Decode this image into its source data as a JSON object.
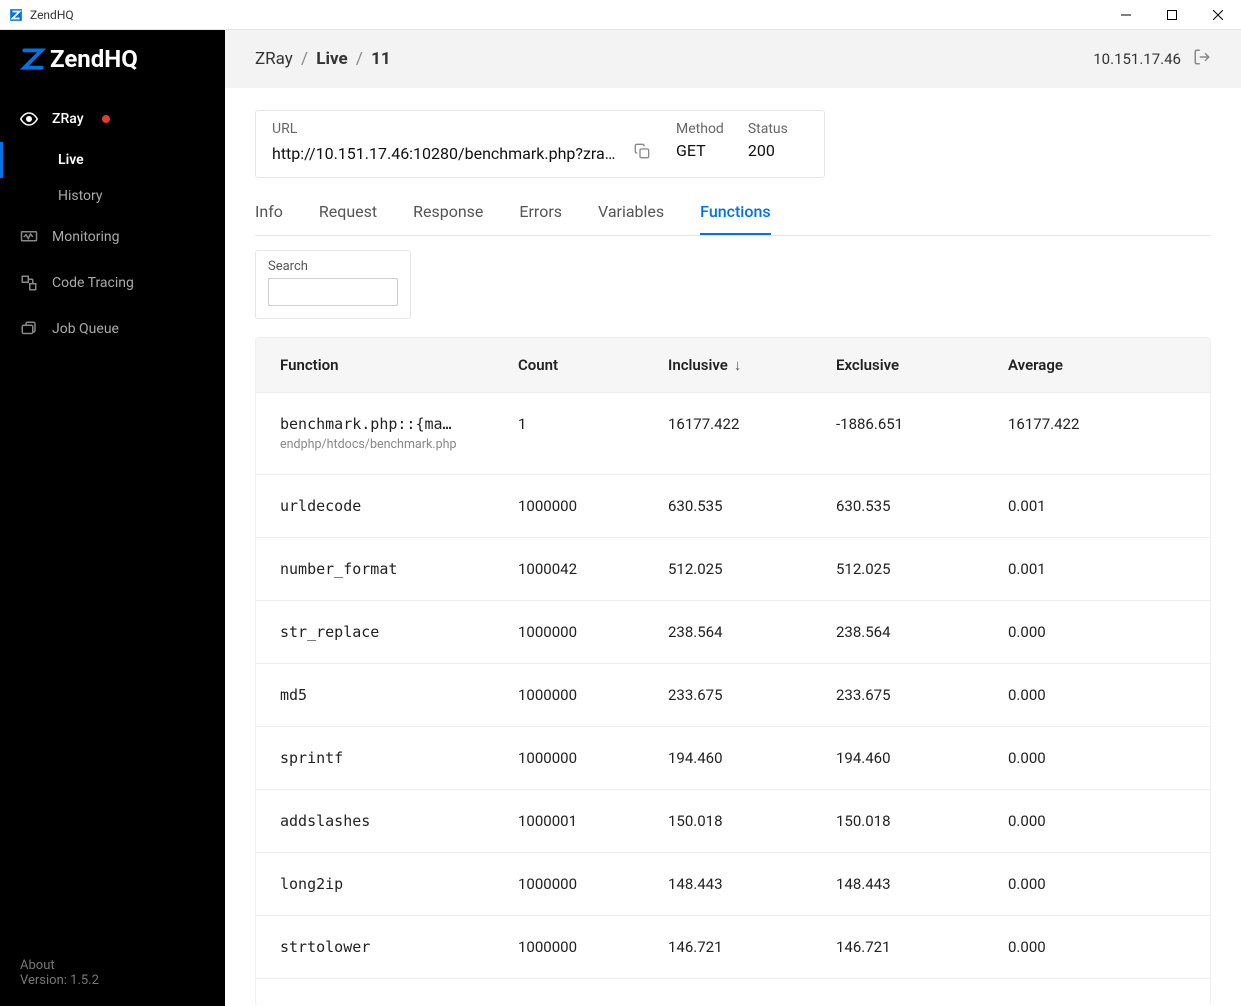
{
  "window": {
    "title": "ZendHQ"
  },
  "brand": {
    "name": "ZendHQ"
  },
  "sidebar": {
    "items": [
      {
        "label": "ZRay",
        "icon": "eye-icon",
        "dot": true
      },
      {
        "label": "Monitoring",
        "icon": "monitor-icon"
      },
      {
        "label": "Code Tracing",
        "icon": "trace-icon"
      },
      {
        "label": "Job Queue",
        "icon": "queue-icon"
      }
    ],
    "zray_sub": [
      {
        "label": "Live",
        "active": true
      },
      {
        "label": "History",
        "active": false
      }
    ],
    "footer": {
      "about": "About",
      "version": "Version: 1.5.2"
    }
  },
  "breadcrumb": {
    "p0": "ZRay",
    "p1": "Live",
    "p2": "11"
  },
  "topbar": {
    "ip": "10.151.17.46"
  },
  "request": {
    "url_label": "URL",
    "url": "http://10.151.17.46:10280/benchmark.php?zra…",
    "method_label": "Method",
    "method": "GET",
    "status_label": "Status",
    "status": "200"
  },
  "tabs": [
    {
      "label": "Info",
      "active": false
    },
    {
      "label": "Request",
      "active": false
    },
    {
      "label": "Response",
      "active": false
    },
    {
      "label": "Errors",
      "active": false
    },
    {
      "label": "Variables",
      "active": false
    },
    {
      "label": "Functions",
      "active": true
    }
  ],
  "search": {
    "label": "Search"
  },
  "table": {
    "headers": {
      "fn": "Function",
      "count": "Count",
      "incl": "Inclusive",
      "excl": "Exclusive",
      "avg": "Average"
    },
    "sort": {
      "column": "incl",
      "dir": "desc"
    },
    "rows": [
      {
        "fn": "benchmark.php::{ma…",
        "path": "endphp/htdocs/benchmark.php",
        "count": "1",
        "incl": "16177.422",
        "excl": "-1886.651",
        "avg": "16177.422"
      },
      {
        "fn": "urldecode",
        "path": "",
        "count": "1000000",
        "incl": "630.535",
        "excl": "630.535",
        "avg": "0.001"
      },
      {
        "fn": "number_format",
        "path": "",
        "count": "1000042",
        "incl": "512.025",
        "excl": "512.025",
        "avg": "0.001"
      },
      {
        "fn": "str_replace",
        "path": "",
        "count": "1000000",
        "incl": "238.564",
        "excl": "238.564",
        "avg": "0.000"
      },
      {
        "fn": "md5",
        "path": "",
        "count": "1000000",
        "incl": "233.675",
        "excl": "233.675",
        "avg": "0.000"
      },
      {
        "fn": "sprintf",
        "path": "",
        "count": "1000000",
        "incl": "194.460",
        "excl": "194.460",
        "avg": "0.000"
      },
      {
        "fn": "addslashes",
        "path": "",
        "count": "1000001",
        "incl": "150.018",
        "excl": "150.018",
        "avg": "0.000"
      },
      {
        "fn": "long2ip",
        "path": "",
        "count": "1000000",
        "incl": "148.443",
        "excl": "148.443",
        "avg": "0.000"
      },
      {
        "fn": "strtolower",
        "path": "",
        "count": "1000000",
        "incl": "146.721",
        "excl": "146.721",
        "avg": "0.000"
      }
    ]
  }
}
